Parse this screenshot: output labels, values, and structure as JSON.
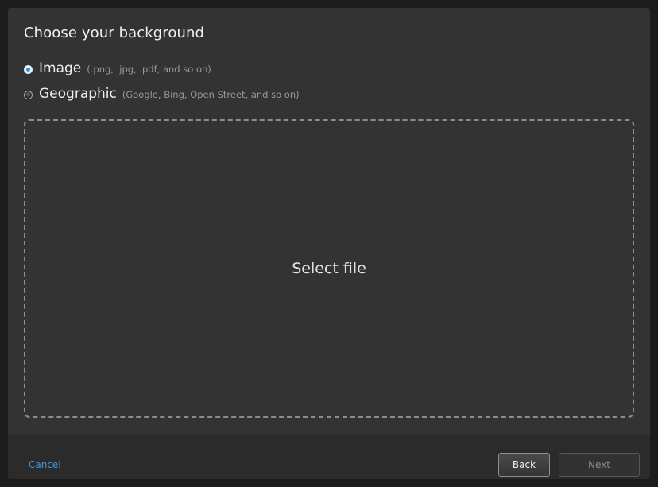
{
  "dialog": {
    "title": "Choose your background",
    "options": [
      {
        "label": "Image",
        "hint": "(.png, .jpg, .pdf, and so on)",
        "selected": true
      },
      {
        "label": "Geographic",
        "hint": "(Google, Bing, Open Street, and so on)",
        "selected": false
      }
    ],
    "dropzone_label": "Select file"
  },
  "footer": {
    "cancel_label": "Cancel",
    "back_label": "Back",
    "next_label": "Next"
  },
  "colors": {
    "accent": "#3f97e0",
    "dialog_bg": "#333333",
    "footer_bg": "#2b2b2b",
    "window_bg": "#1c1c1c"
  }
}
